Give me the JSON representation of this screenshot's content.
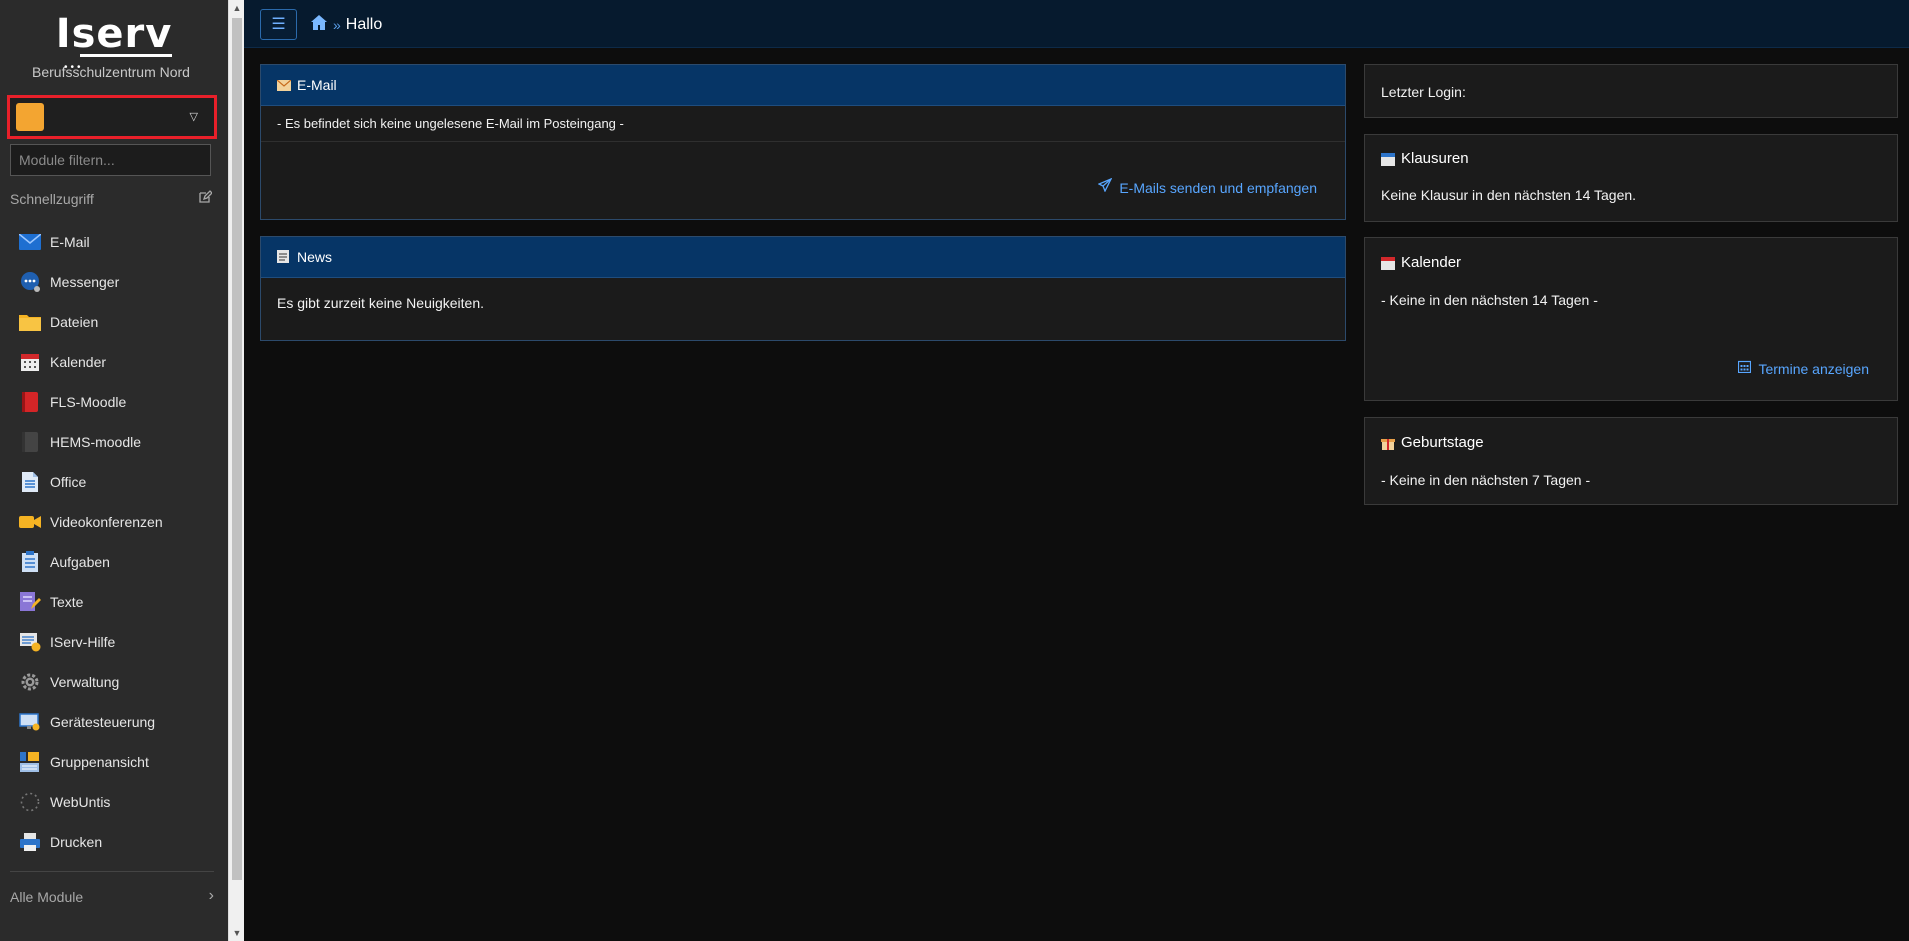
{
  "sidebar": {
    "logo": "Iserv",
    "school": "Berufsschulzentrum Nord",
    "filter_placeholder": "Module filtern...",
    "quick_access": "Schnellzugriff",
    "items": [
      {
        "label": "E-Mail",
        "icon": "mail-icon"
      },
      {
        "label": "Messenger",
        "icon": "messenger-icon"
      },
      {
        "label": "Dateien",
        "icon": "folder-icon"
      },
      {
        "label": "Kalender",
        "icon": "calendar-icon"
      },
      {
        "label": "FLS-Moodle",
        "icon": "moodle-icon"
      },
      {
        "label": "HEMS-moodle",
        "icon": "moodle-dark-icon"
      },
      {
        "label": "Office",
        "icon": "document-icon"
      },
      {
        "label": "Videokonferenzen",
        "icon": "video-icon"
      },
      {
        "label": "Aufgaben",
        "icon": "tasks-icon"
      },
      {
        "label": "Texte",
        "icon": "text-edit-icon"
      },
      {
        "label": "IServ-Hilfe",
        "icon": "help-icon"
      },
      {
        "label": "Verwaltung",
        "icon": "gear-icon"
      },
      {
        "label": "Gerätesteuerung",
        "icon": "monitor-icon"
      },
      {
        "label": "Gruppenansicht",
        "icon": "group-view-icon"
      },
      {
        "label": "WebUntis",
        "icon": "loading-icon"
      },
      {
        "label": "Drucken",
        "icon": "printer-icon"
      }
    ],
    "all_modules": "Alle Module"
  },
  "topbar": {
    "breadcrumb_separator": "»",
    "page_title": "Hallo"
  },
  "email_panel": {
    "title": "E-Mail",
    "status": "- Es befindet sich keine ungelesene E-Mail im Posteingang -",
    "link": "E-Mails senden und empfangen"
  },
  "news_panel": {
    "title": "News",
    "status": "Es gibt zurzeit keine Neuigkeiten."
  },
  "last_login": {
    "label": "Letzter Login:"
  },
  "exams": {
    "title": "Klausuren",
    "body": "Keine Klausur in den nächsten 14 Tagen."
  },
  "calendar": {
    "title": "Kalender",
    "body": "- Keine in den nächsten 14 Tagen -",
    "link": "Termine anzeigen"
  },
  "birthdays": {
    "title": "Geburtstage",
    "body": "- Keine in den nächsten 7 Tagen -"
  },
  "colors": {
    "accent": "#58a6ff",
    "header_blue": "#063566",
    "topbar": "#061a2e",
    "highlight_border": "#e8202a",
    "avatar": "#f3a531"
  }
}
